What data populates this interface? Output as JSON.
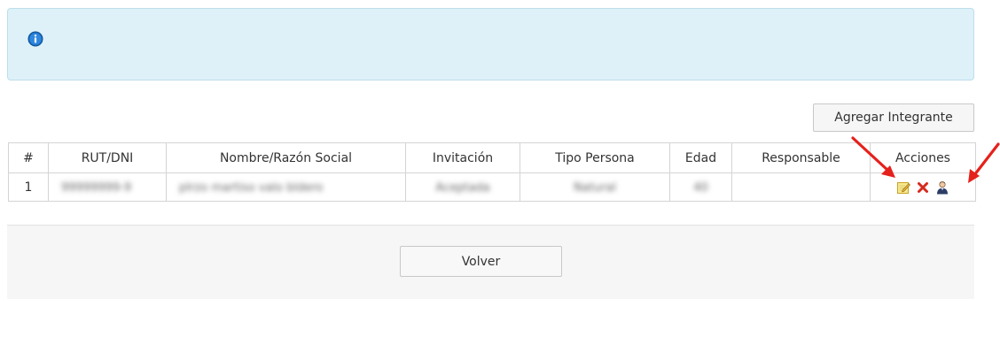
{
  "info_box": {
    "icon": "info-icon"
  },
  "toolbar": {
    "add_member_label": "Agregar Integrante"
  },
  "table": {
    "headers": [
      "#",
      "RUT/DNI",
      "Nombre/Razón Social",
      "Invitación",
      "Tipo Persona",
      "Edad",
      "Responsable",
      "Acciones"
    ],
    "rows": [
      {
        "index": "1",
        "rut": "99999999-9",
        "name": "pIrzo martiso valo bldero",
        "invitation": "Aceptada",
        "person_type": "Natural",
        "age": "40",
        "responsible": ""
      }
    ],
    "actions": {
      "edit_icon": "edit-icon",
      "delete_icon": "delete-icon",
      "responsible_icon": "user-icon"
    }
  },
  "footer": {
    "back_label": "Volver"
  },
  "annotations": {
    "arrow_color": "#e5211c"
  }
}
